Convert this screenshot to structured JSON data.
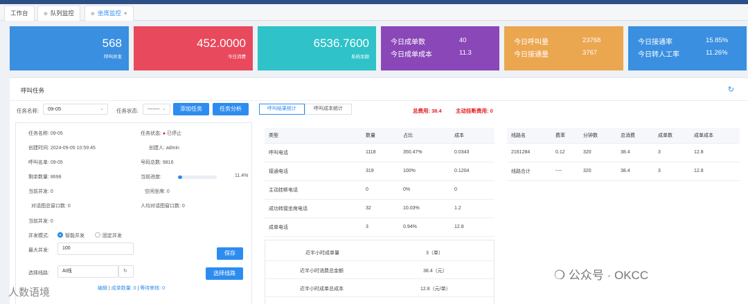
{
  "tabs": [
    {
      "label": "工作台",
      "icon": ""
    },
    {
      "label": "队列监控",
      "icon": "gear-icon"
    },
    {
      "label": "坐席监控",
      "icon": "gear-icon",
      "active": true
    }
  ],
  "cards": {
    "concurrent": {
      "value": "568",
      "label": "呼叫并发",
      "color": "#3a8fe0"
    },
    "consumption": {
      "value": "452.0000",
      "label": "今日消费",
      "color": "#e8495c"
    },
    "balance": {
      "value": "6536.7600",
      "label": "系统余额",
      "color": "#2fc2c8"
    },
    "orders": {
      "l1": "今日成单数",
      "v1": "40",
      "l2": "今日成单成本",
      "v2": "11.3",
      "color": "#8a47b8"
    },
    "calls": {
      "l1": "今日呼叫量",
      "v1": "23768",
      "l2": "今日接通量",
      "v2": "3767",
      "color": "#eba650"
    },
    "rates": {
      "l1": "今日接通率",
      "v1": "15.85%",
      "l2": "今日转人工率",
      "v2": "11.26%",
      "color": "#3a8fe0"
    }
  },
  "panel": {
    "title": "呼叫任务",
    "filters": {
      "task_name_label": "任务名称:",
      "task_name_value": "09-05",
      "task_status_label": "任务状态:",
      "task_status_value": "-------",
      "add_task": "添加任务",
      "task_analysis": "任务分析"
    },
    "segments": [
      "呼叫结果统计",
      "呼叫成本统计"
    ],
    "summary_red": {
      "total_cost": "总费用: 38.4",
      "active_hangup_cost": "主动挂断费用: 0"
    }
  },
  "info": {
    "task_name": "任务名称: 09-05",
    "task_status_label": "任务状态:",
    "task_status_value": "已停止",
    "created_time": "创建时间: 2024-09-05 10:59:45",
    "creator": "创建人: admin",
    "call_list": "呼叫名单: 09-05",
    "number_total": "号码总数: 9816",
    "remaining": "剩余数量: 8698",
    "progress_label": "当前进度:",
    "progress_value": "11.4%",
    "progress_fraction": 0.114,
    "current_concurrency": "当前并发: 0",
    "idle_seats": "空闲坐席: 0",
    "dialog_window": "对话图总窗口数: 0",
    "avg_dialog_window": "人均对话图窗口数: 0",
    "current_concurrency2": "当前并发: 0",
    "mode_label": "并发模式:",
    "mode_smart": "智能并发",
    "mode_fixed": "固定并发",
    "max_concurrency_label": "最大并发:",
    "max_concurrency_value": "100",
    "save": "保存",
    "line_label": "选择线路:",
    "line_value": "AI线",
    "choose_line": "选择线路",
    "footer_links": [
      "编辑",
      "成单数量: 0",
      "等待审核: 0"
    ]
  },
  "result_table": {
    "headers": [
      "类型",
      "数量",
      "占比",
      "成本"
    ],
    "rows": [
      [
        "呼叫电话",
        "1118",
        "350.47%",
        "0.0343"
      ],
      [
        "接通电话",
        "319",
        "100%",
        "0.1204"
      ],
      [
        "主动挂断电话",
        "0",
        "0%",
        "0"
      ],
      [
        "成功转接坐席电话",
        "32",
        "10.03%",
        "1.2"
      ],
      [
        "成单电话",
        "3",
        "0.94%",
        "12.8"
      ]
    ]
  },
  "half_hour": [
    {
      "label": "近半小时成单量",
      "value": "3（单）"
    },
    {
      "label": "近半小时消费总金额",
      "value": "38.4（元）"
    },
    {
      "label": "近半小时成单总成本",
      "value": "12.8（元/单）"
    }
  ],
  "line_table": {
    "headers": [
      "线路名",
      "费率",
      "分钟数",
      "总消费",
      "成单数",
      "成单成本"
    ],
    "rows": [
      [
        "2161284",
        "0.12",
        "320",
        "38.4",
        "3",
        "12.8"
      ],
      [
        "线路合计",
        "----",
        "320",
        "38.4",
        "3",
        "12.8"
      ]
    ]
  },
  "watermarks": {
    "left": "人数语境",
    "right": "公众号 · OKCC"
  }
}
